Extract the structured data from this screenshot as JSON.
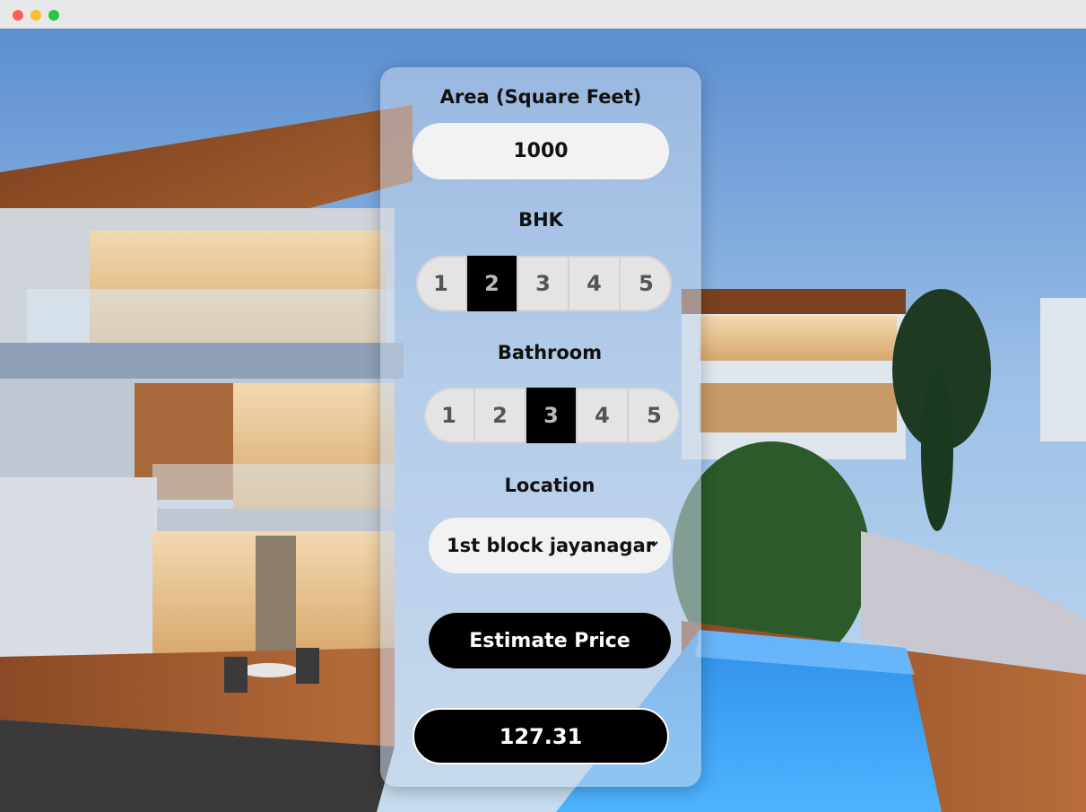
{
  "window": {
    "controls": [
      "close",
      "minimize",
      "maximize"
    ]
  },
  "background": {
    "description_icon": "house-photo"
  },
  "form": {
    "area_label": "Area (Square Feet)",
    "area_value": "1000",
    "bhk_label": "BHK",
    "bhk_options": [
      "1",
      "2",
      "3",
      "4",
      "5"
    ],
    "bhk_selected": "2",
    "bath_label": "Bathroom",
    "bath_options": [
      "1",
      "2",
      "3",
      "4",
      "5"
    ],
    "bath_selected": "3",
    "location_label": "Location",
    "location_value": "1st block jayanagar",
    "estimate_label": "Estimate Price",
    "result_value": "127.31"
  },
  "colors": {
    "accent": "#000000",
    "field_bg": "#f2f2f2",
    "card_bg": "#c8d7eb"
  }
}
